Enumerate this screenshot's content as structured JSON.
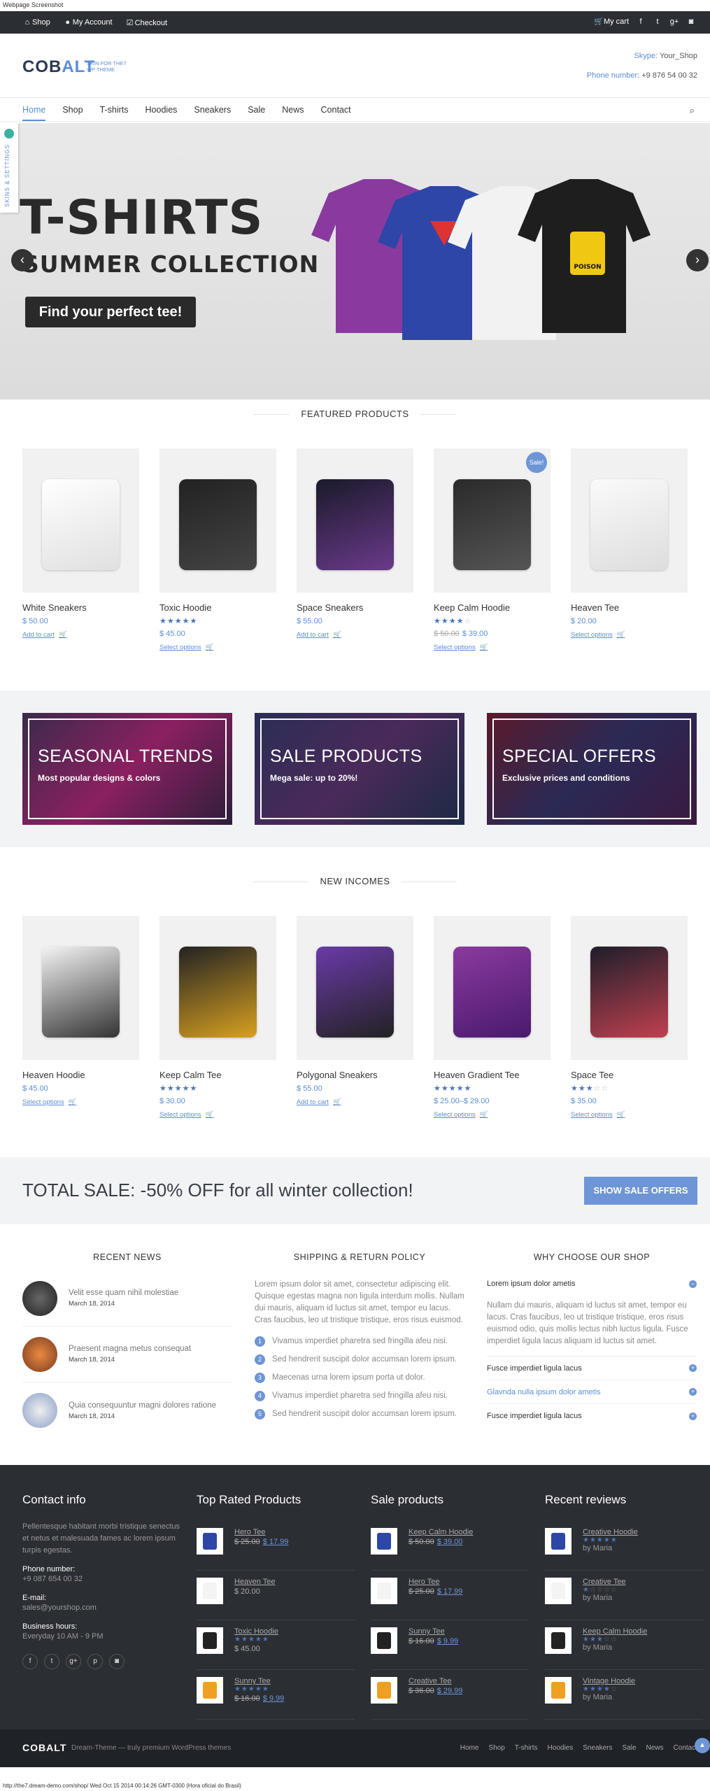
{
  "page_label": "Webpage Screenshot",
  "topbar": {
    "shop": "Shop",
    "account": "My Account",
    "checkout": "Checkout",
    "cart": "My cart"
  },
  "header": {
    "logo_a": "COB",
    "logo_b": "ALT",
    "logo_sub": "SKIN FOR THE7 WP THEME",
    "skype_label": "Skype:",
    "skype_value": "Your_Shop",
    "phone_label": "Phone number:",
    "phone_value": "+9 876 54 00 32"
  },
  "nav": [
    "Home",
    "Shop",
    "T-shirts",
    "Hoodies",
    "Sneakers",
    "Sale",
    "News",
    "Contact"
  ],
  "settings_tab": "SKINS & SETTINGS",
  "hero": {
    "title": "T-SHIRTS",
    "subtitle": "SUMMER COLLECTION",
    "button": "Find your perfect tee!",
    "poison": "POISON"
  },
  "featured": {
    "title": "FEATURED PRODUCTS",
    "items": [
      {
        "name": "White Sneakers",
        "price": "$ 50.00",
        "old": "",
        "stars": 0,
        "action": "Add to cart",
        "sale": ""
      },
      {
        "name": "Toxic Hoodie",
        "price": "$ 45.00",
        "old": "",
        "stars": 5,
        "action": "Select options",
        "sale": ""
      },
      {
        "name": "Space Sneakers",
        "price": "$ 55.00",
        "old": "",
        "stars": 0,
        "action": "Add to cart",
        "sale": ""
      },
      {
        "name": "Keep Calm Hoodie",
        "price": "$ 39.00",
        "old": "$ 50.00",
        "stars": 4,
        "action": "Select options",
        "sale": "Sale!"
      },
      {
        "name": "Heaven Tee",
        "price": "$ 20.00",
        "old": "",
        "stars": 0,
        "action": "Select options",
        "sale": ""
      }
    ]
  },
  "banners": [
    {
      "title": "SEASONAL TRENDS",
      "sub": "Most popular designs & colors"
    },
    {
      "title": "SALE PRODUCTS",
      "sub": "Mega sale: up to 20%!"
    },
    {
      "title": "SPECIAL OFFERS",
      "sub": "Exclusive prices and conditions"
    }
  ],
  "incomes": {
    "title": "NEW INCOMES",
    "items": [
      {
        "name": "Heaven Hoodie",
        "price": "$ 45.00",
        "old": "",
        "stars": 0,
        "action": "Select options"
      },
      {
        "name": "Keep Calm Tee",
        "price": "$ 30.00",
        "old": "",
        "stars": 5,
        "action": "Select options"
      },
      {
        "name": "Polygonal Sneakers",
        "price": "$ 55.00",
        "old": "",
        "stars": 0,
        "action": "Add to cart"
      },
      {
        "name": "Heaven Gradient Tee",
        "price": "$ 25.00–$ 29.00",
        "old": "",
        "stars": 5,
        "action": "Select options"
      },
      {
        "name": "Space Tee",
        "price": "$ 35.00",
        "old": "",
        "stars": 3,
        "action": "Select options"
      }
    ]
  },
  "salebar": {
    "text": "TOTAL SALE: -50% OFF for all winter collection!",
    "button": "SHOW SALE OFFERS"
  },
  "recent_news": {
    "title": "RECENT NEWS",
    "items": [
      {
        "title": "Velit esse quam nihil molestiae",
        "date": "March 18, 2014"
      },
      {
        "title": "Praesent magna metus consequat",
        "date": "March 18, 2014"
      },
      {
        "title": "Quia consequuntur magni dolores ratione",
        "date": "March 18, 2014"
      }
    ]
  },
  "policy": {
    "title": "SHIPPING & RETURN POLICY",
    "text": "Lorem ipsum dolor sit amet, consectetur adipiscing elit. Quisque egestas magna non ligula interdum mollis. Nullam dui mauris, aliquam id luctus sit amet, tempor eu lacus. Cras faucibus, leo ut tristique tristique, eros risus euismod.",
    "list": [
      "Vivamus imperdiet pharetra sed fringilla afeu nisi.",
      "Sed hendrerit suscipit dolor accumsan lorem ipsum.",
      "Maecenas urna lorem ipsum porta ut dolor.",
      "Vivamus imperdiet pharetra sed fringilla afeu nisi.",
      "Sed hendrerit suscipit dolor accumsan lorem ipsum."
    ]
  },
  "why": {
    "title": "WHY CHOOSE OUR SHOP",
    "open_title": "Lorem ipsum dolor ametis",
    "open_text": "Nullam dui mauris, aliquam id luctus sit amet, tempor eu lacus. Cras faucibus, leo ut tristique tristique, eros risus euismod odio, quis mollis lectus nibh luctus ligula. Fusce imperdiet ligula lacus aliquam id luctus sit amet.",
    "items": [
      "Fusce imperdiet ligula lacus",
      "Glavnda nulla ipsum dolor ametis",
      "Fusce imperdiet ligula lacus"
    ]
  },
  "footer": {
    "contact": {
      "title": "Contact info",
      "text": "Pellentesque habitant morbi tristique senectus et netus et malesuada fames ac lorem ipsum turpis egestas.",
      "phone_label": "Phone number:",
      "phone": "+9 087 654 00 32",
      "email_label": "E-mail:",
      "email": "sales@yourshop.com",
      "hours_label": "Business hours:",
      "hours": "Everyday 10 AM - 9 PM"
    },
    "top_rated": {
      "title": "Top Rated Products",
      "items": [
        {
          "name": "Hero Tee",
          "old": "$ 25.00",
          "price": "$ 17.99",
          "stars": 0
        },
        {
          "name": "Heaven Tee",
          "old": "",
          "price": "$ 20.00",
          "stars": 0
        },
        {
          "name": "Toxic Hoodie",
          "old": "",
          "price": "$ 45.00",
          "stars": 5
        },
        {
          "name": "Sunny Tee",
          "old": "$ 16.00",
          "price": "$ 9.99",
          "stars": 5
        }
      ]
    },
    "sale": {
      "title": "Sale products",
      "items": [
        {
          "name": "Keep Calm Hoodie",
          "old": "$ 50.00",
          "price": "$ 39.00"
        },
        {
          "name": "Hero Tee",
          "old": "$ 25.00",
          "price": "$ 17.99"
        },
        {
          "name": "Sunny Tee",
          "old": "$ 16.00",
          "price": "$ 9.99"
        },
        {
          "name": "Creative Tee",
          "old": "$ 36.00",
          "price": "$ 29.99"
        }
      ]
    },
    "reviews": {
      "title": "Recent reviews",
      "items": [
        {
          "name": "Creative Hoodie",
          "stars": 5,
          "by": "by Maria"
        },
        {
          "name": "Creative Tee",
          "stars": 1,
          "by": "by Maria"
        },
        {
          "name": "Keep Calm Hoodie",
          "stars": 3,
          "by": "by Maria"
        },
        {
          "name": "Vintage Hoodie",
          "stars": 4,
          "by": "by Maria"
        }
      ]
    }
  },
  "bottom": {
    "logo": "COBALT",
    "tagline": "Dream-Theme — truly premium WordPress themes",
    "menu": [
      "Home",
      "Shop",
      "T-shirts",
      "Hoodies",
      "Sneakers",
      "Sale",
      "News",
      "Contact"
    ]
  },
  "url": "http://the7.dream-demo.com/shop/ Wed Oct 15 2014 00:14:26 GMT-0300 (Hora oficial do Brasil)",
  "colors": {
    "accent": "#5b8ed4",
    "dark": "#2b2e33",
    "star": "#4d74b4"
  }
}
